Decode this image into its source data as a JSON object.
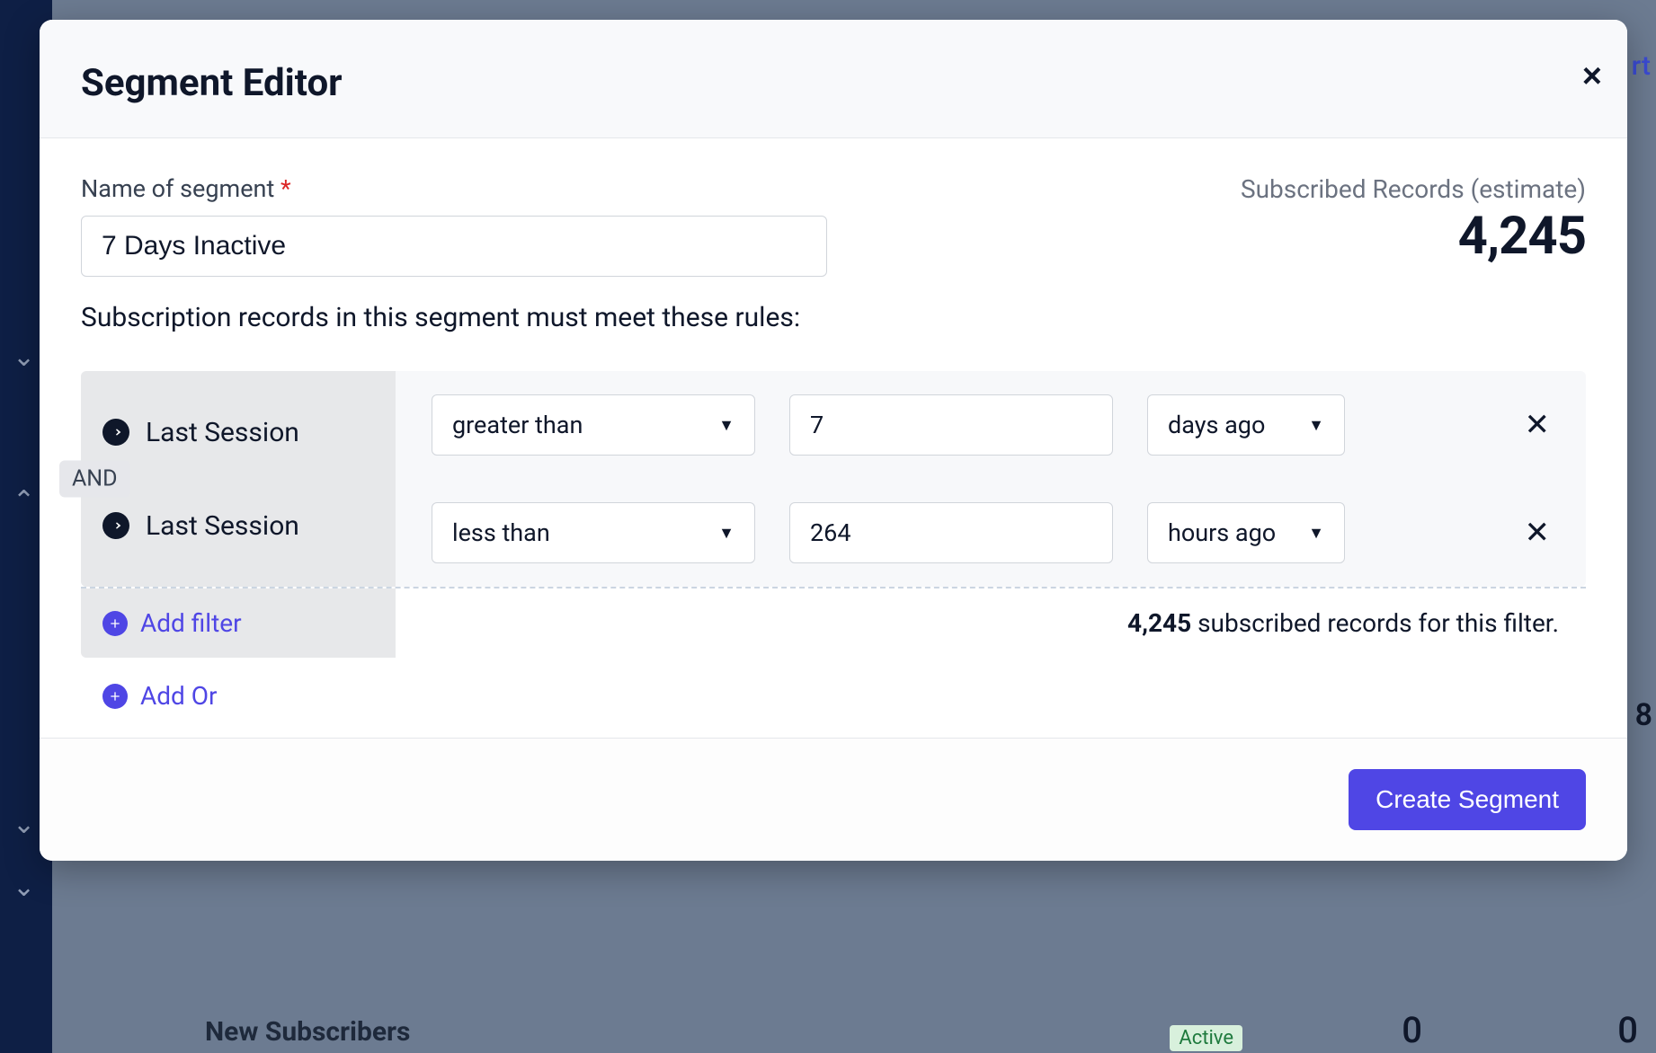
{
  "background": {
    "text_rt": "rt",
    "text_8": "8",
    "new_subscribers": "New Subscribers",
    "active_tag": "Active",
    "zero": "0"
  },
  "modal": {
    "title": "Segment Editor",
    "close_glyph": "×",
    "name_label": "Name of segment",
    "name_value": "7 Days Inactive",
    "estimate_label": "Subscribed Records (estimate)",
    "estimate_value": "4,245",
    "rules_intro": "Subscription records in this segment must meet these rules:",
    "and_label": "AND",
    "rules": [
      {
        "field": "Last Session",
        "operator": "greater than",
        "value": "7",
        "unit": "days ago"
      },
      {
        "field": "Last Session",
        "operator": "less than",
        "value": "264",
        "unit": "hours ago"
      }
    ],
    "add_filter_label": "Add filter",
    "filter_count_bold": "4,245",
    "filter_count_rest": " subscribed records for this filter.",
    "add_or_label": "Add Or",
    "create_label": "Create Segment"
  }
}
